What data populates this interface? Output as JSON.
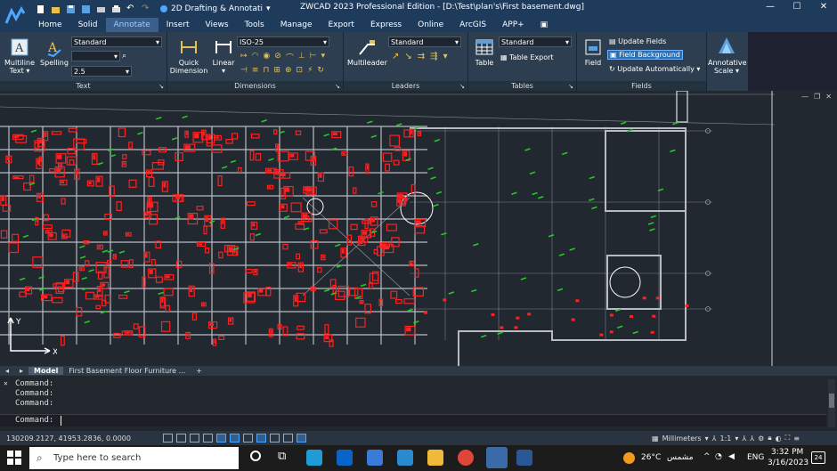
{
  "titlebar": {
    "workspace": "2D Drafting & Annotati",
    "title": "ZWCAD 2023 Professional Edition - [D:\\Test\\plan's\\First basement.dwg]"
  },
  "menubar": [
    "Home",
    "Solid",
    "Annotate",
    "Insert",
    "Views",
    "Tools",
    "Manage",
    "Export",
    "Express",
    "Online",
    "ArcGIS",
    "APP+"
  ],
  "menubar_active": "Annotate",
  "ribbon": {
    "text": {
      "label": "Text",
      "multiline_line1": "Multiline",
      "multiline_line2": "Text ▾",
      "spelling": "Spelling",
      "style": "Standard",
      "height": "2.5"
    },
    "dimensions": {
      "label": "Dimensions",
      "quick_line1": "Quick",
      "quick_line2": "Dimension",
      "linear_line1": "Linear",
      "linear_line2": "▾",
      "style": "ISO-25"
    },
    "leaders": {
      "label": "Leaders",
      "multileader": "Multileader",
      "style": "Standard"
    },
    "tables": {
      "label": "Tables",
      "table": "Table",
      "style": "Standard",
      "table_export": "Table Export"
    },
    "fields": {
      "label": "Fields",
      "field": "Field",
      "update_fields": "Update Fields",
      "field_background": "Field Background",
      "update_automatically": "Update Automatically"
    },
    "annotative": {
      "line1": "Annotative",
      "line2": "Scale ▾"
    }
  },
  "layout_tabs": [
    "Model",
    "First Basement Floor Furniture ..."
  ],
  "layout_tab_plus": "+",
  "command": {
    "history": [
      "Command:",
      "Command:",
      "Command:"
    ],
    "prompt": "Command:"
  },
  "status": {
    "coords": "130209.2127, 41953.2836, 0.0000",
    "units": "Millimeters",
    "scale": "1:1"
  },
  "taskbar": {
    "search_placeholder": "Type here to search",
    "weather": "26°C",
    "weather_text": "مشمس",
    "lang": "ENG",
    "time": "3:32 PM",
    "date": "3/16/2023",
    "notifications": "24"
  },
  "colors": {
    "titlebar": "#1f3b5c",
    "ribbon": "#2c3e50",
    "canvas": "#212830",
    "accent": "#3c8dde",
    "cad_red": "#ff2020",
    "cad_green": "#22cc22"
  }
}
